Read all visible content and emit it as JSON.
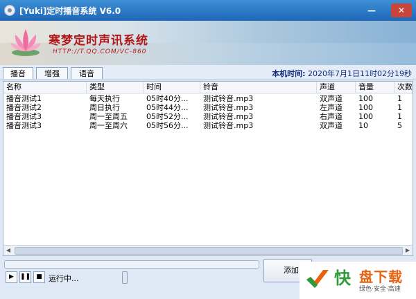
{
  "window": {
    "title": "[Yuki]定时播音系统 V6.0"
  },
  "banner": {
    "brand": "寒梦定时声讯系统",
    "url": "HTTP://T.QQ.COM/VC-860"
  },
  "tabs": [
    {
      "label": "播音",
      "active": true
    },
    {
      "label": "增强",
      "active": false
    },
    {
      "label": "语音",
      "active": false
    }
  ],
  "clock": {
    "label": "本机时间:",
    "value": "2020年7月1日11时02分19秒"
  },
  "table": {
    "columns": [
      "名称",
      "类型",
      "时间",
      "铃音",
      "声道",
      "音量",
      "次数"
    ],
    "rows": [
      [
        "播音测试1",
        "每天执行",
        "05时40分...",
        "测试铃音.mp3",
        "双声道",
        "100",
        "1"
      ],
      [
        "播音测试2",
        "周日执行",
        "05时44分...",
        "测试铃音.mp3",
        "左声道",
        "100",
        "1"
      ],
      [
        "播音测试3",
        "周一至周五",
        "05时52分...",
        "测试铃音.mp3",
        "右声道",
        "100",
        "1"
      ],
      [
        "播音测试3",
        "周一至周六",
        "05时56分...",
        "测试铃音.mp3",
        "双声道",
        "10",
        "5"
      ]
    ]
  },
  "player": {
    "status": "运行中...",
    "add_label": "添加"
  },
  "watermark": {
    "kuai": "快",
    "rest": "盘下载",
    "slogan": "绿色·安全·高速"
  },
  "colors": {
    "title_bar": "#2a78c8",
    "brand_red": "#b21818",
    "clock_blue": "#10287a",
    "badge_green": "#2e9b3a",
    "badge_orange": "#e8620f"
  }
}
